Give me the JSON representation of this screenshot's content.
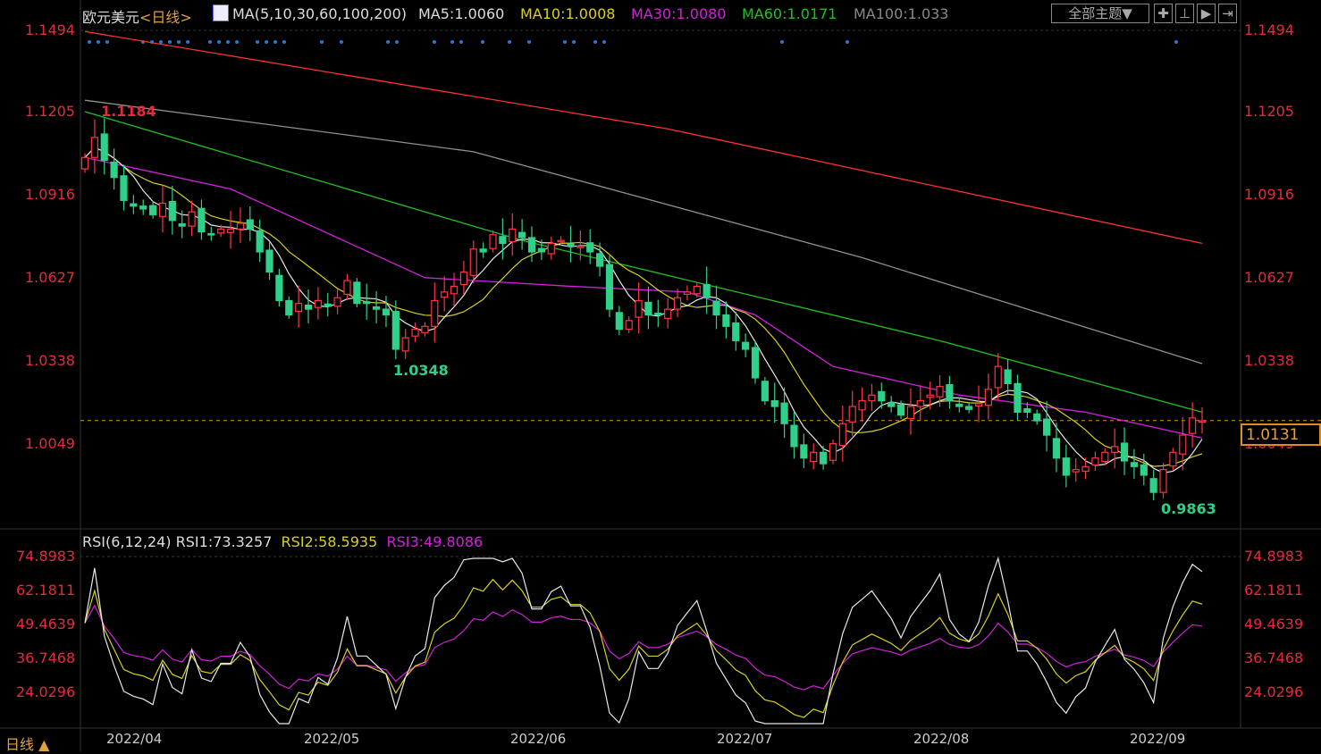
{
  "header": {
    "instrument": "欧元美元",
    "period": "<日线>",
    "ma_label": "MA(5,10,30,60,100,200)",
    "ma5": "MA5:1.0060",
    "ma10": "MA10:1.0008",
    "ma30": "MA30:1.0080",
    "ma60": "MA60:1.0171",
    "ma100": "MA100:1.033"
  },
  "toolbar": {
    "theme_label": "全部主题▼",
    "icons": [
      "crosshair-icon",
      "zoom-range-icon",
      "play-forward-icon",
      "exit-right-icon"
    ]
  },
  "colors": {
    "up": "#ff3344",
    "down": "#2fd08a",
    "ma5": "#e8e8e8",
    "ma10": "#d8d020",
    "ma30": "#d020d8",
    "ma60": "#20c020",
    "ma100": "#909090",
    "ma200": "#ff3030",
    "rsi1": "#e8e8e8",
    "rsi2": "#d8d020",
    "rsi3": "#d020d8",
    "current": "#e08a20"
  },
  "price_axis": {
    "ticks": [
      "1.1494",
      "1.1205",
      "1.0916",
      "1.0627",
      "1.0338",
      "1.0049"
    ]
  },
  "annotations": {
    "high": "1.1184",
    "mid_low": "1.0348",
    "low": "0.9863",
    "current": "1.0131"
  },
  "rsi": {
    "label": "RSI(6,12,24)",
    "rsi1": "RSI1:73.3257",
    "rsi2": "RSI2:58.5935",
    "rsi3": "RSI3:49.8086",
    "ticks": [
      "74.8983",
      "62.1811",
      "49.4639",
      "36.7468",
      "24.0296"
    ]
  },
  "dates": [
    "2022/04",
    "2022/05",
    "2022/06",
    "2022/07",
    "2022/08",
    "2022/09"
  ],
  "footer": {
    "period_label": "日线 ▲"
  },
  "chart_data": {
    "type": "candlestick",
    "ylim": [
      0.98,
      1.155
    ],
    "current_price": 1.0131,
    "closes": [
      1.105,
      1.112,
      1.104,
      1.098,
      1.09,
      1.088,
      1.087,
      1.085,
      1.089,
      1.083,
      1.081,
      1.086,
      1.079,
      1.078,
      1.08,
      1.08,
      1.082,
      1.08,
      1.072,
      1.065,
      1.055,
      1.05,
      1.054,
      1.052,
      1.055,
      1.053,
      1.056,
      1.062,
      1.054,
      1.054,
      1.052,
      1.05,
      1.038,
      1.042,
      1.045,
      1.046,
      1.055,
      1.058,
      1.06,
      1.065,
      1.073,
      1.072,
      1.078,
      1.075,
      1.08,
      1.077,
      1.072,
      1.072,
      1.075,
      1.076,
      1.074,
      1.074,
      1.072,
      1.067,
      1.052,
      1.045,
      1.048,
      1.055,
      1.05,
      1.05,
      1.052,
      1.056,
      1.058,
      1.06,
      1.056,
      1.05,
      1.046,
      1.041,
      1.038,
      1.028,
      1.02,
      1.018,
      1.012,
      1.004,
      1.0,
      1.002,
      0.998,
      1.005,
      1.012,
      1.018,
      1.02,
      1.022,
      1.02,
      1.018,
      1.015,
      1.018,
      1.02,
      1.022,
      1.025,
      1.02,
      1.018,
      1.017,
      1.019,
      1.024,
      1.032,
      1.026,
      1.016,
      1.016,
      1.013,
      1.008,
      1.0,
      0.994,
      0.996,
      0.997,
      1.0,
      1.002,
      1.004,
      0.999,
      0.997,
      0.994,
      0.988,
      0.996,
      1.002,
      1.008,
      1.014,
      1.013
    ],
    "ma_keypoints": {
      "ma30": [
        [
          0,
          1.105
        ],
        [
          15,
          1.094
        ],
        [
          35,
          1.063
        ],
        [
          50,
          1.06
        ],
        [
          62,
          1.058
        ],
        [
          69,
          1.05
        ],
        [
          77,
          1.032
        ],
        [
          90,
          1.022
        ],
        [
          103,
          1.016
        ],
        [
          115,
          1.007
        ]
      ],
      "ma60": [
        [
          0,
          1.121
        ],
        [
          45,
          1.076
        ],
        [
          88,
          1.041
        ],
        [
          115,
          1.016
        ]
      ],
      "ma100": [
        [
          0,
          1.125
        ],
        [
          40,
          1.107
        ],
        [
          80,
          1.07
        ],
        [
          115,
          1.033
        ]
      ],
      "ma200": [
        [
          0,
          1.149
        ],
        [
          60,
          1.115
        ],
        [
          115,
          1.075
        ]
      ]
    }
  }
}
